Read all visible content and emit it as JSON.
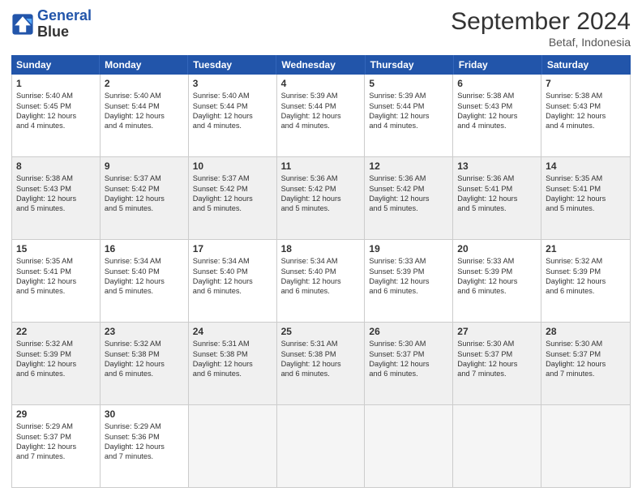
{
  "logo": {
    "line1": "General",
    "line2": "Blue"
  },
  "title": "September 2024",
  "subtitle": "Betaf, Indonesia",
  "days": [
    "Sunday",
    "Monday",
    "Tuesday",
    "Wednesday",
    "Thursday",
    "Friday",
    "Saturday"
  ],
  "weeks": [
    [
      {
        "day": "1",
        "info": "Sunrise: 5:40 AM\nSunset: 5:45 PM\nDaylight: 12 hours\nand 4 minutes."
      },
      {
        "day": "2",
        "info": "Sunrise: 5:40 AM\nSunset: 5:44 PM\nDaylight: 12 hours\nand 4 minutes."
      },
      {
        "day": "3",
        "info": "Sunrise: 5:40 AM\nSunset: 5:44 PM\nDaylight: 12 hours\nand 4 minutes."
      },
      {
        "day": "4",
        "info": "Sunrise: 5:39 AM\nSunset: 5:44 PM\nDaylight: 12 hours\nand 4 minutes."
      },
      {
        "day": "5",
        "info": "Sunrise: 5:39 AM\nSunset: 5:44 PM\nDaylight: 12 hours\nand 4 minutes."
      },
      {
        "day": "6",
        "info": "Sunrise: 5:38 AM\nSunset: 5:43 PM\nDaylight: 12 hours\nand 4 minutes."
      },
      {
        "day": "7",
        "info": "Sunrise: 5:38 AM\nSunset: 5:43 PM\nDaylight: 12 hours\nand 4 minutes."
      }
    ],
    [
      {
        "day": "8",
        "info": "Sunrise: 5:38 AM\nSunset: 5:43 PM\nDaylight: 12 hours\nand 5 minutes."
      },
      {
        "day": "9",
        "info": "Sunrise: 5:37 AM\nSunset: 5:42 PM\nDaylight: 12 hours\nand 5 minutes."
      },
      {
        "day": "10",
        "info": "Sunrise: 5:37 AM\nSunset: 5:42 PM\nDaylight: 12 hours\nand 5 minutes."
      },
      {
        "day": "11",
        "info": "Sunrise: 5:36 AM\nSunset: 5:42 PM\nDaylight: 12 hours\nand 5 minutes."
      },
      {
        "day": "12",
        "info": "Sunrise: 5:36 AM\nSunset: 5:42 PM\nDaylight: 12 hours\nand 5 minutes."
      },
      {
        "day": "13",
        "info": "Sunrise: 5:36 AM\nSunset: 5:41 PM\nDaylight: 12 hours\nand 5 minutes."
      },
      {
        "day": "14",
        "info": "Sunrise: 5:35 AM\nSunset: 5:41 PM\nDaylight: 12 hours\nand 5 minutes."
      }
    ],
    [
      {
        "day": "15",
        "info": "Sunrise: 5:35 AM\nSunset: 5:41 PM\nDaylight: 12 hours\nand 5 minutes."
      },
      {
        "day": "16",
        "info": "Sunrise: 5:34 AM\nSunset: 5:40 PM\nDaylight: 12 hours\nand 5 minutes."
      },
      {
        "day": "17",
        "info": "Sunrise: 5:34 AM\nSunset: 5:40 PM\nDaylight: 12 hours\nand 6 minutes."
      },
      {
        "day": "18",
        "info": "Sunrise: 5:34 AM\nSunset: 5:40 PM\nDaylight: 12 hours\nand 6 minutes."
      },
      {
        "day": "19",
        "info": "Sunrise: 5:33 AM\nSunset: 5:39 PM\nDaylight: 12 hours\nand 6 minutes."
      },
      {
        "day": "20",
        "info": "Sunrise: 5:33 AM\nSunset: 5:39 PM\nDaylight: 12 hours\nand 6 minutes."
      },
      {
        "day": "21",
        "info": "Sunrise: 5:32 AM\nSunset: 5:39 PM\nDaylight: 12 hours\nand 6 minutes."
      }
    ],
    [
      {
        "day": "22",
        "info": "Sunrise: 5:32 AM\nSunset: 5:39 PM\nDaylight: 12 hours\nand 6 minutes."
      },
      {
        "day": "23",
        "info": "Sunrise: 5:32 AM\nSunset: 5:38 PM\nDaylight: 12 hours\nand 6 minutes."
      },
      {
        "day": "24",
        "info": "Sunrise: 5:31 AM\nSunset: 5:38 PM\nDaylight: 12 hours\nand 6 minutes."
      },
      {
        "day": "25",
        "info": "Sunrise: 5:31 AM\nSunset: 5:38 PM\nDaylight: 12 hours\nand 6 minutes."
      },
      {
        "day": "26",
        "info": "Sunrise: 5:30 AM\nSunset: 5:37 PM\nDaylight: 12 hours\nand 6 minutes."
      },
      {
        "day": "27",
        "info": "Sunrise: 5:30 AM\nSunset: 5:37 PM\nDaylight: 12 hours\nand 7 minutes."
      },
      {
        "day": "28",
        "info": "Sunrise: 5:30 AM\nSunset: 5:37 PM\nDaylight: 12 hours\nand 7 minutes."
      }
    ],
    [
      {
        "day": "29",
        "info": "Sunrise: 5:29 AM\nSunset: 5:37 PM\nDaylight: 12 hours\nand 7 minutes."
      },
      {
        "day": "30",
        "info": "Sunrise: 5:29 AM\nSunset: 5:36 PM\nDaylight: 12 hours\nand 7 minutes."
      },
      {
        "day": "",
        "info": ""
      },
      {
        "day": "",
        "info": ""
      },
      {
        "day": "",
        "info": ""
      },
      {
        "day": "",
        "info": ""
      },
      {
        "day": "",
        "info": ""
      }
    ]
  ]
}
